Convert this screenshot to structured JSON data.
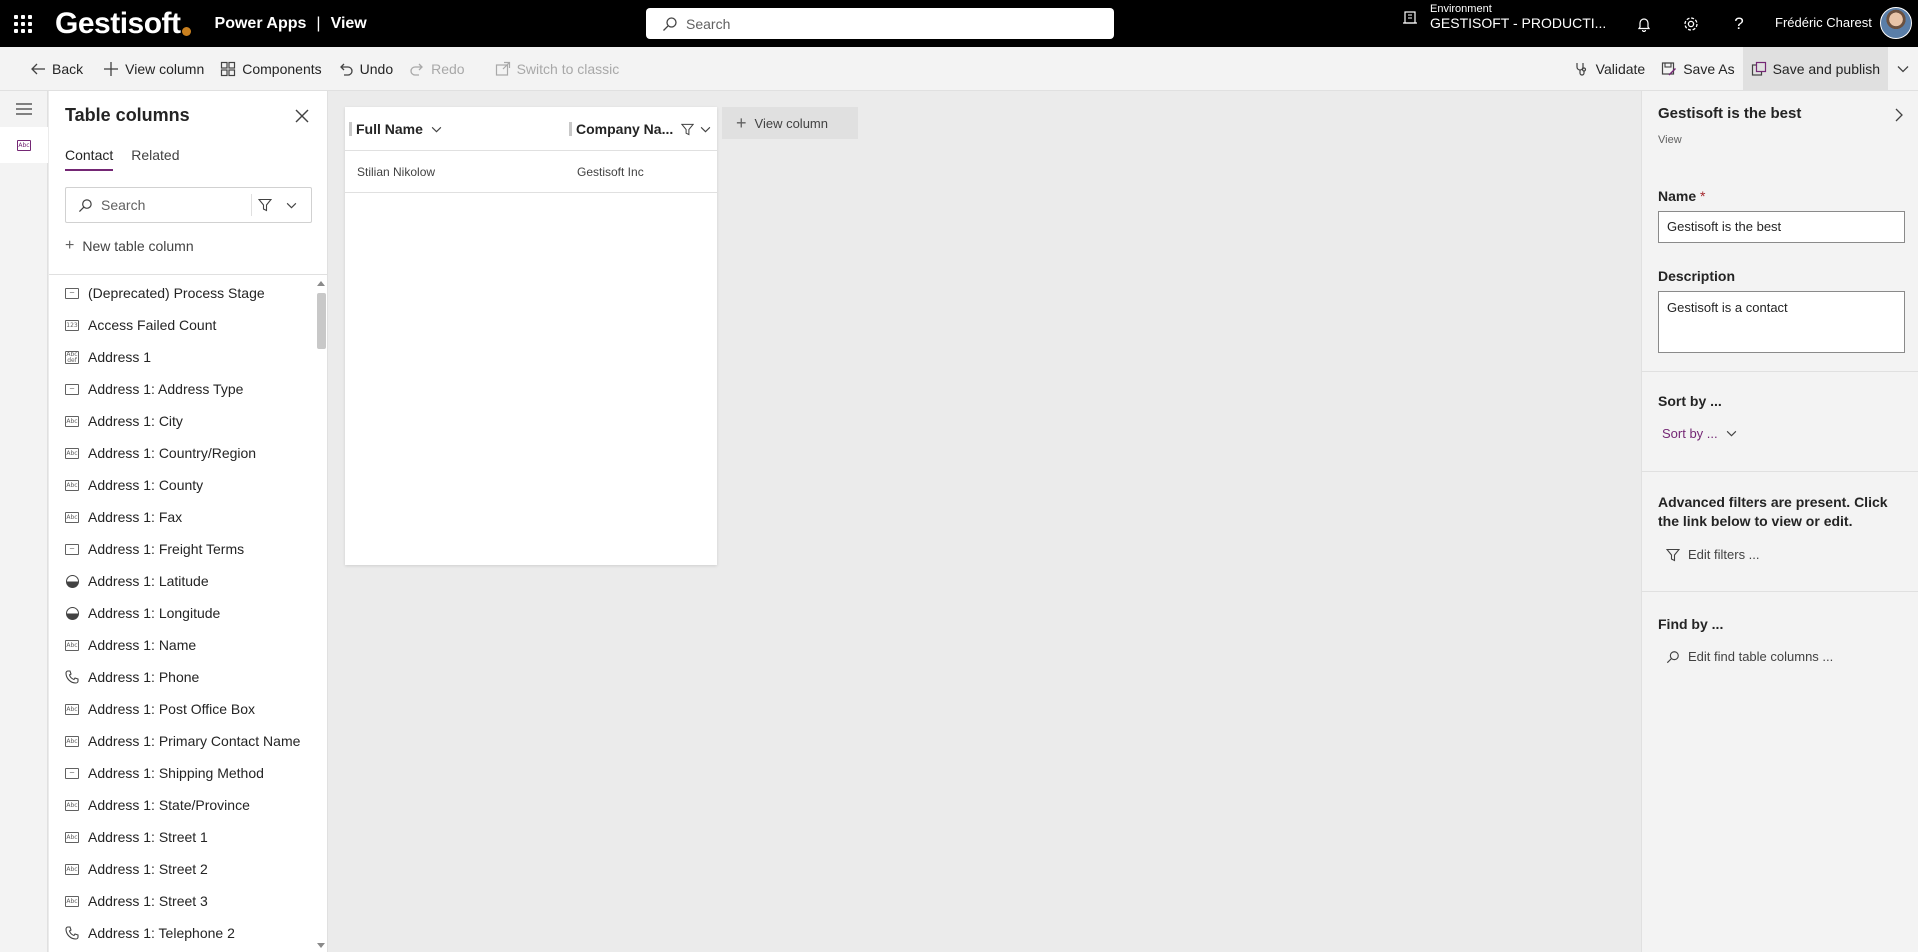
{
  "topbar": {
    "logo": "Gestisoft",
    "app_name": "Power Apps",
    "separator": "|",
    "view_name": "View",
    "search_placeholder": "Search",
    "environment_label": "Environment",
    "environment_name": "GESTISOFT - PRODUCTI...",
    "user_name": "Frédéric Charest"
  },
  "commandbar": {
    "back": "Back",
    "view_column": "View column",
    "components": "Components",
    "undo": "Undo",
    "redo": "Redo",
    "switch_classic": "Switch to classic",
    "validate": "Validate",
    "save_as": "Save As",
    "save_publish": "Save and publish"
  },
  "columns_panel": {
    "title": "Table columns",
    "tabs": [
      "Contact",
      "Related"
    ],
    "search_placeholder": "Search",
    "new_column": "New table column",
    "items": [
      {
        "label": "(Deprecated) Process Stage",
        "icon": "option-set-icon"
      },
      {
        "label": "Access Failed Count",
        "icon": "number-icon"
      },
      {
        "label": "Address 1",
        "icon": "multiline-text-icon"
      },
      {
        "label": "Address 1: Address Type",
        "icon": "option-set-icon"
      },
      {
        "label": "Address 1: City",
        "icon": "text-icon"
      },
      {
        "label": "Address 1: Country/Region",
        "icon": "text-icon"
      },
      {
        "label": "Address 1: County",
        "icon": "text-icon"
      },
      {
        "label": "Address 1: Fax",
        "icon": "text-icon"
      },
      {
        "label": "Address 1: Freight Terms",
        "icon": "option-set-icon"
      },
      {
        "label": "Address 1: Latitude",
        "icon": "decimal-icon"
      },
      {
        "label": "Address 1: Longitude",
        "icon": "decimal-icon"
      },
      {
        "label": "Address 1: Name",
        "icon": "text-icon"
      },
      {
        "label": "Address 1: Phone",
        "icon": "phone-icon"
      },
      {
        "label": "Address 1: Post Office Box",
        "icon": "text-icon"
      },
      {
        "label": "Address 1: Primary Contact Name",
        "icon": "text-icon"
      },
      {
        "label": "Address 1: Shipping Method",
        "icon": "option-set-icon"
      },
      {
        "label": "Address 1: State/Province",
        "icon": "text-icon"
      },
      {
        "label": "Address 1: Street 1",
        "icon": "text-icon"
      },
      {
        "label": "Address 1: Street 2",
        "icon": "text-icon"
      },
      {
        "label": "Address 1: Street 3",
        "icon": "text-icon"
      },
      {
        "label": "Address 1: Telephone 2",
        "icon": "phone-icon"
      }
    ]
  },
  "grid": {
    "columns": [
      "Full Name",
      "Company Na..."
    ],
    "rows": [
      [
        "Stilian Nikolow",
        "Gestisoft Inc"
      ]
    ],
    "add_column": "View column"
  },
  "properties": {
    "title": "Gestisoft is the best",
    "subtitle": "View",
    "name_label": "Name",
    "required_mark": "*",
    "name_value": "Gestisoft is the best",
    "description_label": "Description",
    "description_value": "Gestisoft is a contact",
    "sort_label": "Sort by ...",
    "sort_dropdown": "Sort by ...",
    "filters_text": "Advanced filters are present. Click the link below to view or edit.",
    "edit_filters": "Edit filters ...",
    "find_label": "Find by ...",
    "edit_find": "Edit find table columns ..."
  },
  "colors": {
    "accent": "#742774",
    "topbar": "#000000",
    "canvas": "#ebebeb"
  }
}
